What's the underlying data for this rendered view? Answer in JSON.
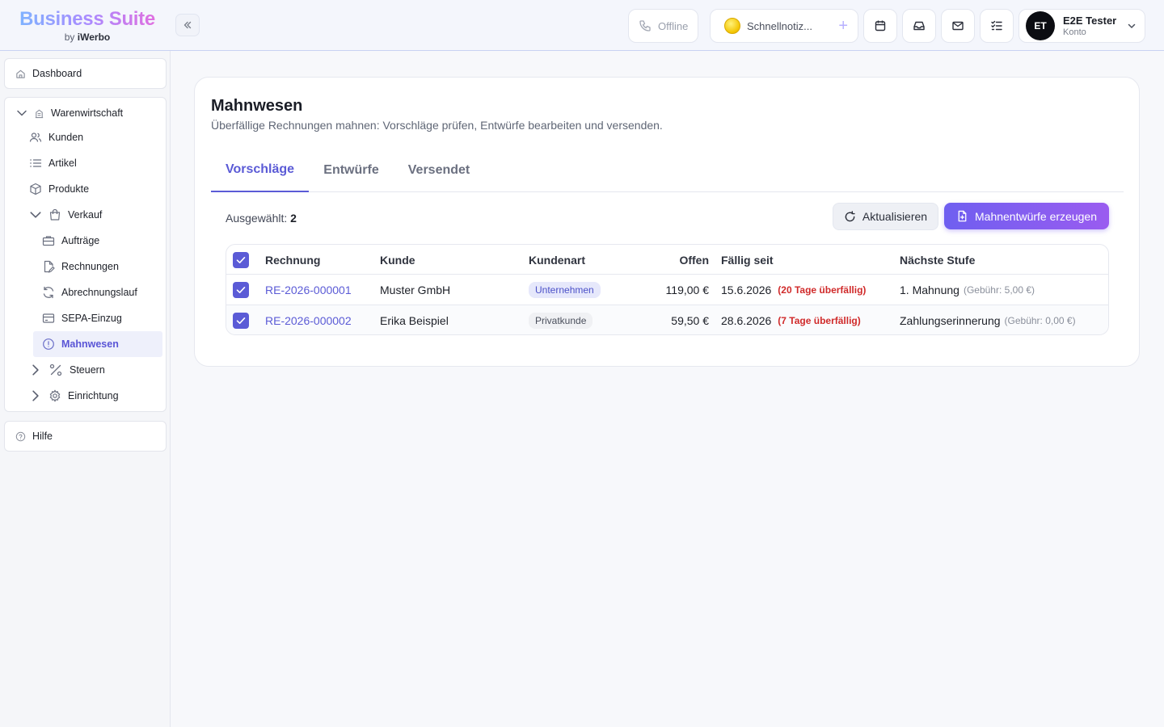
{
  "brand": {
    "title": "Business Suite",
    "by": "by",
    "company": "iWerbo"
  },
  "header": {
    "offline_label": "Offline",
    "notiz_label": "Schnellnotiz...",
    "notiz_plus": "+",
    "user": {
      "initials": "ET",
      "name": "E2E Tester",
      "role": "Konto"
    }
  },
  "sidebar": {
    "dashboard": "Dashboard",
    "group": "Warenwirtschaft",
    "kunden": "Kunden",
    "artikel": "Artikel",
    "produkte": "Produkte",
    "verkauf": "Verkauf",
    "auftraege": "Aufträge",
    "rechnungen": "Rechnungen",
    "abrechnungslauf": "Abrechnungslauf",
    "sepa": "SEPA-Einzug",
    "mahnwesen": "Mahnwesen",
    "steuern": "Steuern",
    "einrichtung": "Einrichtung",
    "hilfe": "Hilfe"
  },
  "page": {
    "title": "Mahnwesen",
    "subtitle": "Überfällige Rechnungen mahnen: Vorschläge prüfen, Entwürfe bearbeiten und versenden."
  },
  "tabs": [
    "Vorschläge",
    "Entwürfe",
    "Versendet"
  ],
  "selection": {
    "label": "Ausgewählt:",
    "count": "2"
  },
  "actions": {
    "refresh": "Aktualisieren",
    "create": "Mahnentwürfe erzeugen"
  },
  "table": {
    "headers": {
      "invoice": "Rechnung",
      "customer": "Kunde",
      "type": "Kundenart",
      "open": "Offen",
      "due": "Fällig seit",
      "next": "Nächste Stufe"
    },
    "rows": [
      {
        "invoice": "RE-2026-000001",
        "customer": "Muster GmbH",
        "type": "Unternehmen",
        "open": "119,00 €",
        "due": "15.6.2026",
        "overdue": "(20 Tage überfällig)",
        "next": "1. Mahnung",
        "fee": "(Gebühr: 5,00 €)"
      },
      {
        "invoice": "RE-2026-000002",
        "customer": "Erika Beispiel",
        "type": "Privatkunde",
        "open": "59,50 €",
        "due": "28.6.2026",
        "overdue": "(7 Tage überfällig)",
        "next": "Zahlungserinnerung",
        "fee": "(Gebühr: 0,00 €)"
      }
    ]
  },
  "colors": {
    "accent": "#5b5bd6",
    "overdue": "#d02a2a"
  }
}
